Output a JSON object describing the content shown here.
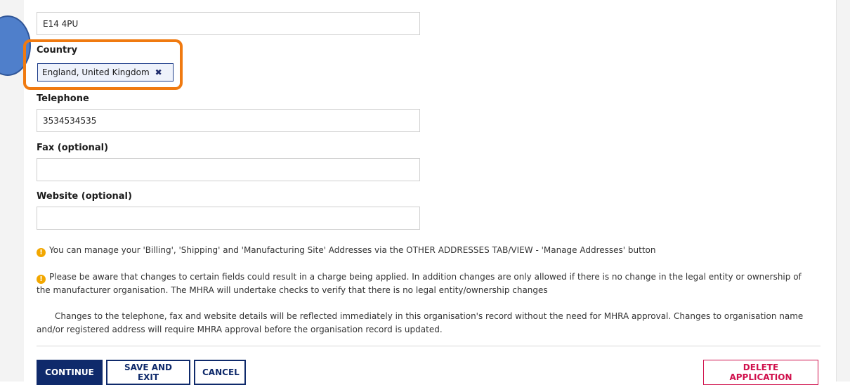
{
  "postcode": {
    "value": "E14 4PU"
  },
  "country": {
    "label": "Country",
    "selected": "England, United Kingdom",
    "remove_glyph": "✖"
  },
  "telephone": {
    "label": "Telephone",
    "value": "3534534535"
  },
  "fax": {
    "label": "Fax (optional)",
    "value": ""
  },
  "website": {
    "label": "Website (optional)",
    "value": ""
  },
  "notices": {
    "warn_glyph": "!",
    "addresses": "You can manage your 'Billing', 'Shipping' and 'Manufacturing Site' Addresses via the OTHER ADDRESSES TAB/VIEW - 'Manage Addresses' button",
    "charges": "Please be aware that changes to certain fields could result in a charge being applied. In addition changes are only allowed if there is no change in the legal entity or ownership of the manufacturer organisation. The MHRA will undertake checks to verify that there is no legal entity/ownership changes",
    "approval": "Changes to the telephone, fax and website details will be reflected immediately in this organisation's record without the need for MHRA approval. Changes to organisation name and/or registered address will require MHRA approval before the organisation record is updated."
  },
  "actions": {
    "continue": "CONTINUE",
    "save_exit": "SAVE AND EXIT",
    "cancel": "CANCEL",
    "delete": "DELETE APPLICATION"
  },
  "colors": {
    "primary": "#0f2a6b",
    "danger": "#d0104c",
    "highlight": "#f07a10",
    "marker": "#4f7fcb",
    "warning": "#f2a700"
  }
}
